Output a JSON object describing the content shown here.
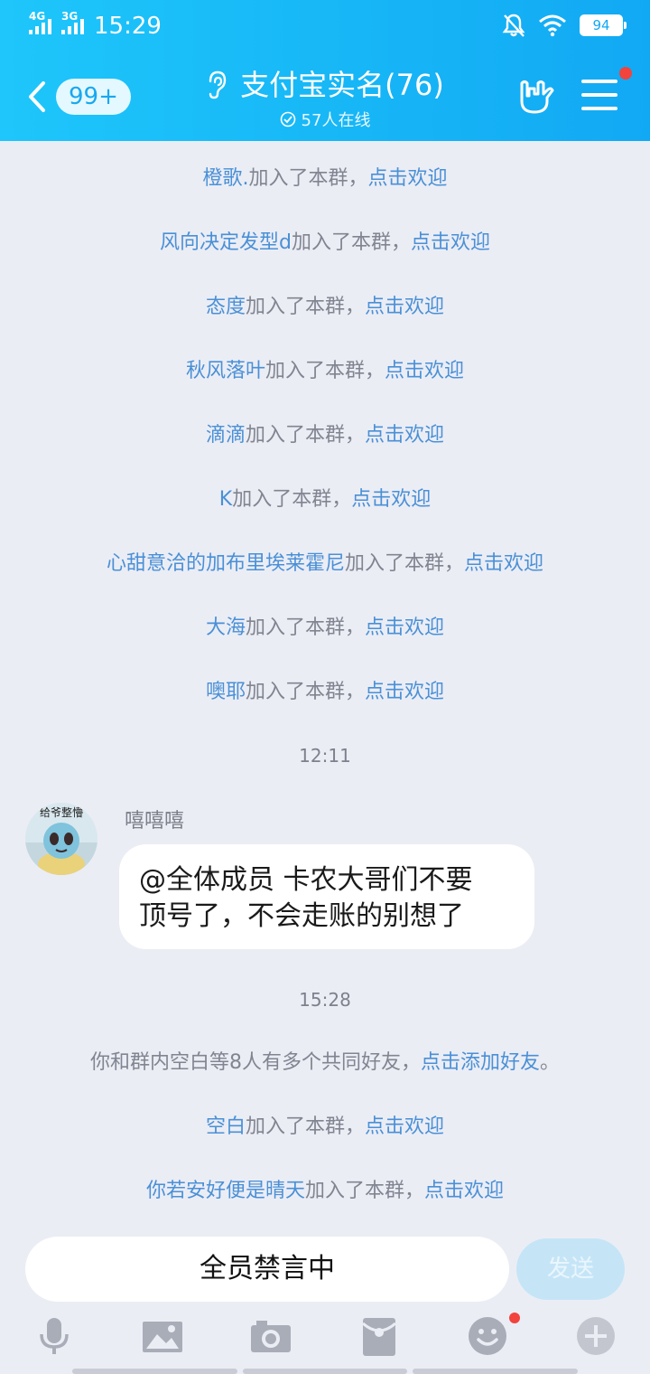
{
  "status_bar": {
    "net1": "4G",
    "net2": "3G",
    "time": "15:29",
    "battery": "94"
  },
  "header": {
    "unread_badge": "99+",
    "title": "支付宝实名(76)",
    "online": "57人在线",
    "accent_color": "#17b6f6"
  },
  "join_suffix": "加入了本群，",
  "welcome_link": "点击欢迎",
  "messages_top": [
    {
      "nick": "橙歌."
    },
    {
      "nick": "风向决定发型d"
    },
    {
      "nick": "态度"
    },
    {
      "nick": "秋风落叶"
    },
    {
      "nick": "滴滴"
    },
    {
      "nick": "K"
    },
    {
      "nick": "心甜意洽的加布里埃莱霍尼"
    },
    {
      "nick": "大海"
    },
    {
      "nick": "噢耶"
    }
  ],
  "time_1": "12:11",
  "chat_message": {
    "sender": "嘻嘻嘻",
    "avatar_text": "给爷整懵",
    "text_line1": "@全体成员 卡农大哥们不要",
    "text_line2": "顶号了，不会走账的别想了"
  },
  "time_2": "15:28",
  "friends_notice": {
    "text": "你和群内空白等8人有多个共同好友，",
    "link": "点击添加好友",
    "end": "。"
  },
  "messages_bottom": [
    {
      "nick": "空白"
    },
    {
      "nick": "你若安好便是晴天"
    }
  ],
  "input": {
    "muted_text": "全员禁言中",
    "send_label": "发送"
  },
  "toolbar_icons": [
    "mic-icon",
    "image-icon",
    "camera-icon",
    "red-packet-icon",
    "emoji-icon",
    "plus-icon"
  ]
}
